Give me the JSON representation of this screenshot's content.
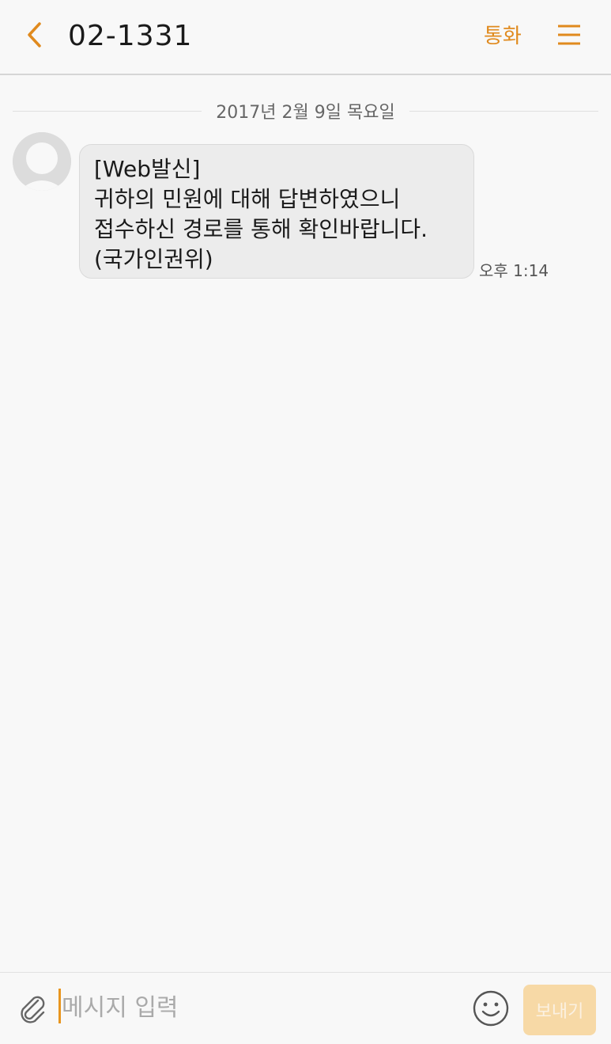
{
  "header": {
    "title": "02-1331",
    "call_label": "통화",
    "back_icon": "chevron-left-icon",
    "menu_icon": "hamburger-menu-icon"
  },
  "conversation": {
    "date": "2017년 2월 9일 목요일",
    "messages": [
      {
        "lines": [
          "[Web발신]",
          "귀하의 민원에 대해 답변하였으니",
          "접수하신 경로를 통해 확인바랍니다.",
          "(국가인권위)"
        ],
        "time": "오후 1:14"
      }
    ]
  },
  "composer": {
    "placeholder": "메시지 입력",
    "value": "",
    "send_label": "보내기",
    "attach_icon": "paperclip-icon",
    "emoji_icon": "smiley-icon"
  },
  "colors": {
    "accent": "#e08a1e",
    "bubble": "#ececec",
    "background": "#f8f8f8",
    "send_disabled": "#f7d9a6"
  }
}
